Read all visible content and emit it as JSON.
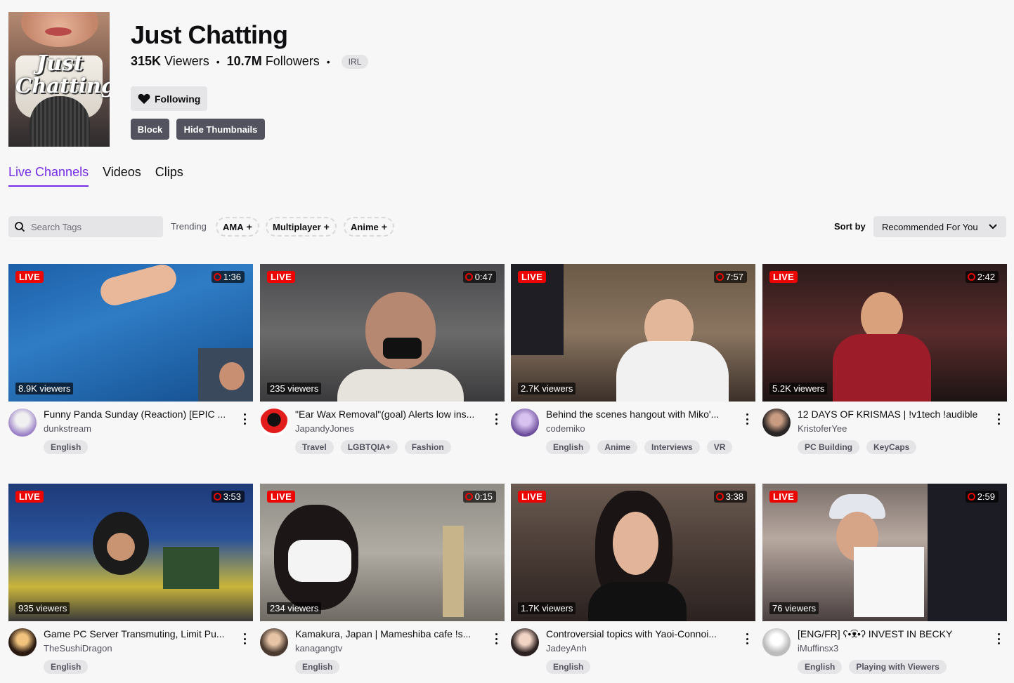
{
  "category": {
    "title": "Just Chatting",
    "viewers_count": "315K",
    "viewers_label": "Viewers",
    "followers_count": "10.7M",
    "followers_label": "Followers",
    "tag": "IRL",
    "boxart_text_line1": "Just",
    "boxart_text_line2": "Chatting"
  },
  "actions": {
    "following_label": "Following",
    "block_label": "Block",
    "hide_thumbnails_label": "Hide Thumbnails"
  },
  "tabs": [
    {
      "label": "Live Channels",
      "active": true
    },
    {
      "label": "Videos",
      "active": false
    },
    {
      "label": "Clips",
      "active": false
    }
  ],
  "filters": {
    "search_placeholder": "Search Tags",
    "trending_label": "Trending",
    "trending_tags": [
      "AMA",
      "Multiplayer",
      "Anime"
    ],
    "sort_label": "Sort by",
    "sort_value": "Recommended For You"
  },
  "colors": {
    "accent": "#772ce8",
    "live_red": "#eb0400",
    "background": "#f7f7f8"
  },
  "streams": [
    {
      "live": "LIVE",
      "uptime": "1:36",
      "viewers": "8.9K viewers",
      "title": "Funny Panda Sunday (Reaction) [EPIC ...",
      "channel": "dunkstream",
      "tags": [
        "English"
      ]
    },
    {
      "live": "LIVE",
      "uptime": "0:47",
      "viewers": "235 viewers",
      "title": "\"Ear Wax Removal\"(goal) Alerts low ins...",
      "channel": "JapandyJones",
      "tags": [
        "Travel",
        "LGBTQIA+",
        "Fashion"
      ]
    },
    {
      "live": "LIVE",
      "uptime": "7:57",
      "viewers": "2.7K viewers",
      "title": "Behind the scenes hangout with Miko'...",
      "channel": "codemiko",
      "tags": [
        "English",
        "Anime",
        "Interviews",
        "VR"
      ]
    },
    {
      "live": "LIVE",
      "uptime": "2:42",
      "viewers": "5.2K viewers",
      "title": "12 DAYS OF KRISMAS | !v1tech !audible",
      "channel": "KristoferYee",
      "tags": [
        "PC Building",
        "KeyCaps"
      ]
    },
    {
      "live": "LIVE",
      "uptime": "3:53",
      "viewers": "935 viewers",
      "title": "Game PC Server Transmuting, Limit Pu...",
      "channel": "TheSushiDragon",
      "tags": [
        "English"
      ]
    },
    {
      "live": "LIVE",
      "uptime": "0:15",
      "viewers": "234 viewers",
      "title": "Kamakura, Japan | Mameshiba cafe !s...",
      "channel": "kanagangtv",
      "tags": [
        "English"
      ]
    },
    {
      "live": "LIVE",
      "uptime": "3:38",
      "viewers": "1.7K viewers",
      "title": "Controversial topics with Yaoi-Connoi...",
      "channel": "JadeyAnh",
      "tags": [
        "English"
      ]
    },
    {
      "live": "LIVE",
      "uptime": "2:59",
      "viewers": "76 viewers",
      "title": "[ENG/FR] ʕ•͡ᴥ•ʔ INVEST IN BECKY",
      "channel": "iMuffinsx3",
      "tags": [
        "English",
        "Playing with Viewers"
      ]
    }
  ]
}
